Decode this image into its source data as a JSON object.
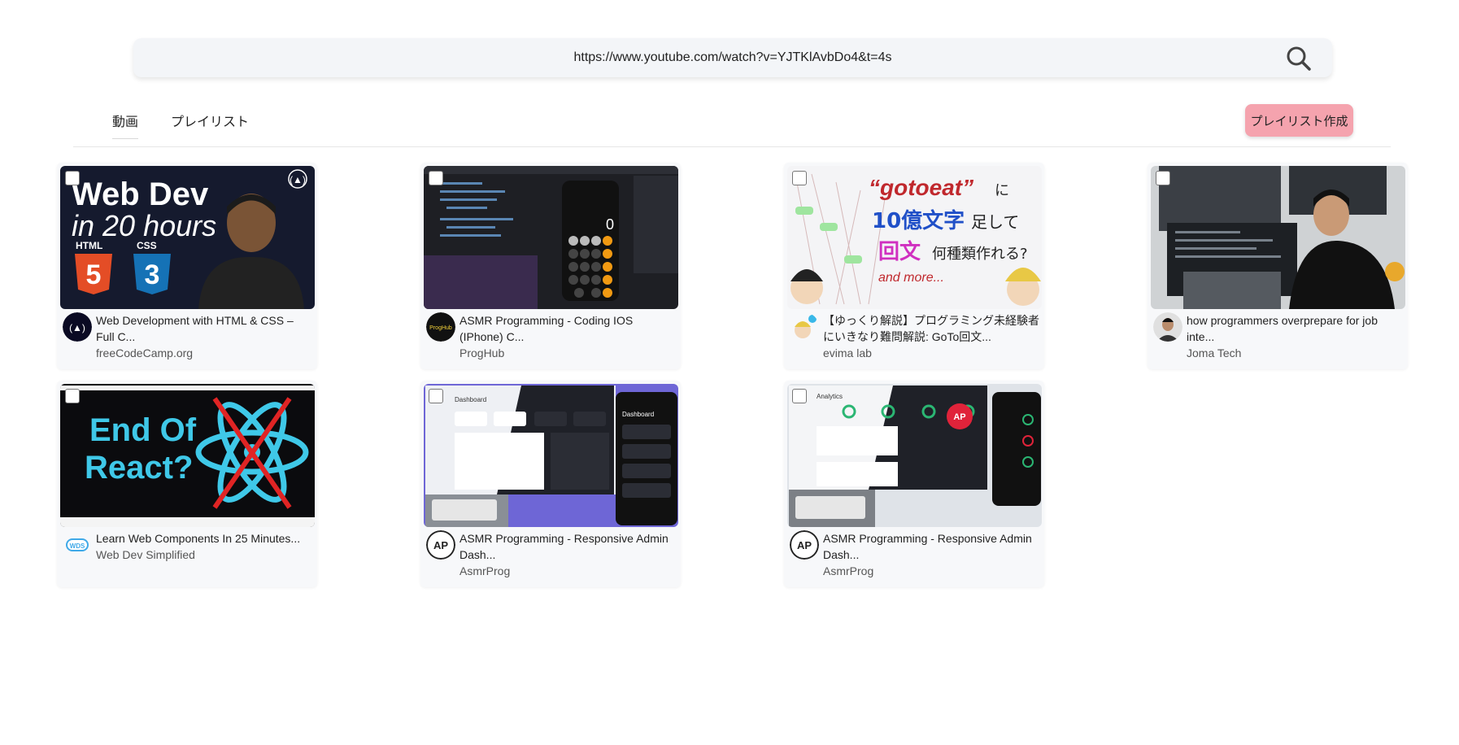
{
  "search": {
    "url": "https://www.youtube.com/watch?v=YJTKlAvbDo4&t=4s"
  },
  "tabs": [
    {
      "label": "動画"
    },
    {
      "label": "プレイリスト"
    }
  ],
  "create_playlist_label": "プレイリスト作成",
  "videos": [
    {
      "title": "Web Development with HTML & CSS – Full C...",
      "channel": "freeCodeCamp.org",
      "thumb_text": [
        "Web Dev",
        "in 20 hours",
        "HTML",
        "CSS"
      ]
    },
    {
      "title": "ASMR Programming - Coding IOS (IPhone) C...",
      "channel": "ProgHub",
      "thumb_text": [
        "0",
        "ProgHub"
      ]
    },
    {
      "title": "【ゆっくり解説】プログラミング未経験者にいきなり難問解説: GoTo回文...",
      "channel": "evima lab",
      "thumb_text": [
        "“gotoeat”",
        "に",
        "10億文字",
        "足して",
        "回文",
        "何種類作れる?",
        "and more..."
      ]
    },
    {
      "title": "how programmers overprepare for job inte...",
      "channel": "Joma Tech",
      "thumb_text": []
    },
    {
      "title": "Learn Web Components In 25 Minutes...",
      "channel": "Web Dev Simplified",
      "thumb_text": [
        "End Of",
        "React?",
        "WDS"
      ]
    },
    {
      "title": "ASMR Programming - Responsive Admin Dash...",
      "channel": "AsmrProg",
      "thumb_text": [
        "Dashboard"
      ]
    },
    {
      "title": "ASMR Programming - Responsive Admin Dash...",
      "channel": "AsmrProg",
      "thumb_text": [
        "Analytics"
      ]
    }
  ],
  "colors": {
    "accent_button": "#f5a3ae",
    "search_bg": "#f3f5f8",
    "card_bg": "#f7f8fa"
  },
  "icons": {
    "search": "search-icon",
    "checkbox": "checkbox"
  }
}
